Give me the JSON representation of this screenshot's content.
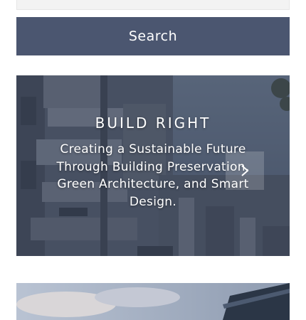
{
  "search": {
    "button_label": "Search"
  },
  "hero": {
    "title": "BUILD RIGHT",
    "tagline": "Creating a Sustainable Future Through Building Preservation, Green Architecture, and Smart Design.",
    "next_icon": "chevron-right-icon"
  },
  "colors": {
    "button_bg": "#4b5670",
    "overlay": "#28344e",
    "text": "#ffffff"
  }
}
